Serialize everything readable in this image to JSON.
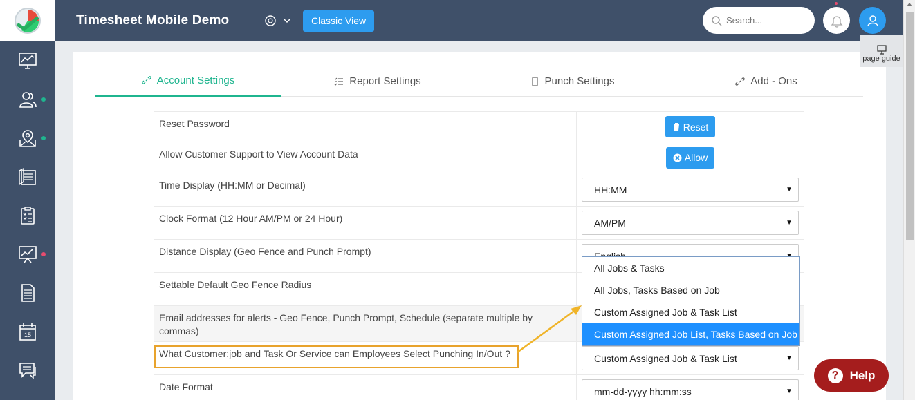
{
  "app_title": "Timesheet Mobile Demo",
  "classic_view_label": "Classic View",
  "search": {
    "placeholder": "Search..."
  },
  "page_guide_label": "page guide",
  "help_label": "Help",
  "tabs": [
    {
      "label": "Account Settings",
      "icon": "link-icon",
      "active": true
    },
    {
      "label": "Report Settings",
      "icon": "list-check-icon"
    },
    {
      "label": "Punch Settings",
      "icon": "mobile-icon"
    },
    {
      "label": "Add - Ons",
      "icon": "link-icon"
    }
  ],
  "settings": {
    "reset_password": {
      "label": "Reset Password",
      "button": "Reset"
    },
    "allow_support": {
      "label": "Allow Customer Support to View Account Data",
      "button": "Allow"
    },
    "time_display": {
      "label": "Time Display (HH:MM or Decimal)",
      "value": "HH:MM"
    },
    "clock_format": {
      "label": "Clock Format (12 Hour AM/PM or 24 Hour)",
      "value": "AM/PM"
    },
    "distance_display": {
      "label": "Distance Display (Geo Fence and Punch Prompt)",
      "value": "English"
    },
    "geofence_radius": {
      "label": "Settable Default Geo Fence Radius"
    },
    "email_alerts": {
      "label": "Email addresses for alerts - Geo Fence, Punch Prompt, Schedule (separate multiple by commas)"
    },
    "job_task": {
      "label": "What Customer:job and Task Or Service can Employees Select Punching In/Out ?",
      "value": "Custom Assigned Job & Task List"
    },
    "date_format": {
      "label": "Date Format",
      "value": "mm-dd-yyyy hh:mm:ss"
    }
  },
  "dropdown_options": [
    "All Jobs & Tasks",
    "All Jobs, Tasks Based on Job",
    "Custom Assigned Job & Task List",
    "Custom Assigned Job List, Tasks Based on Job"
  ],
  "dropdown_selected_index": 3,
  "colors": {
    "sidebar": "#3f5069",
    "accent": "#2d9cef",
    "active_tab": "#1fb58f",
    "highlight": "#e8a32d",
    "help": "#a51d1d"
  }
}
